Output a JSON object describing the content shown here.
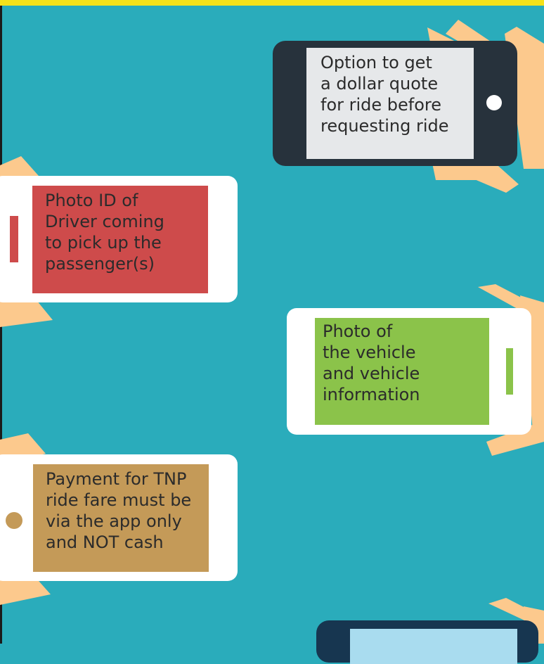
{
  "background_color": "#2aacbb",
  "top_bar_color": "#f5e21a",
  "cards": [
    {
      "lines": [
        "Option to get",
        "a dollar quote",
        "for ride before",
        "requesting ride"
      ],
      "phone_color": "#27323c",
      "screen_color": "#e6e8ea",
      "indicator": "button-dot"
    },
    {
      "lines": [
        "Photo ID of",
        "Driver coming",
        "to pick up the",
        "passenger(s)"
      ],
      "phone_color": "#ffffff",
      "screen_color": "#ce4b4b",
      "indicator": "bar"
    },
    {
      "lines": [
        "Photo of",
        "the vehicle",
        "and vehicle",
        "information"
      ],
      "phone_color": "#ffffff",
      "screen_color": "#8bc34a",
      "indicator": "bar"
    },
    {
      "lines": [
        "Payment for TNP",
        "ride fare must be",
        "via the app only",
        "and NOT cash"
      ],
      "phone_color": "#ffffff",
      "screen_color": "#c49a58",
      "indicator": "button-dot"
    },
    {
      "lines": [],
      "phone_color": "#173650",
      "screen_color": "#a9dcef",
      "indicator": "none"
    }
  ]
}
